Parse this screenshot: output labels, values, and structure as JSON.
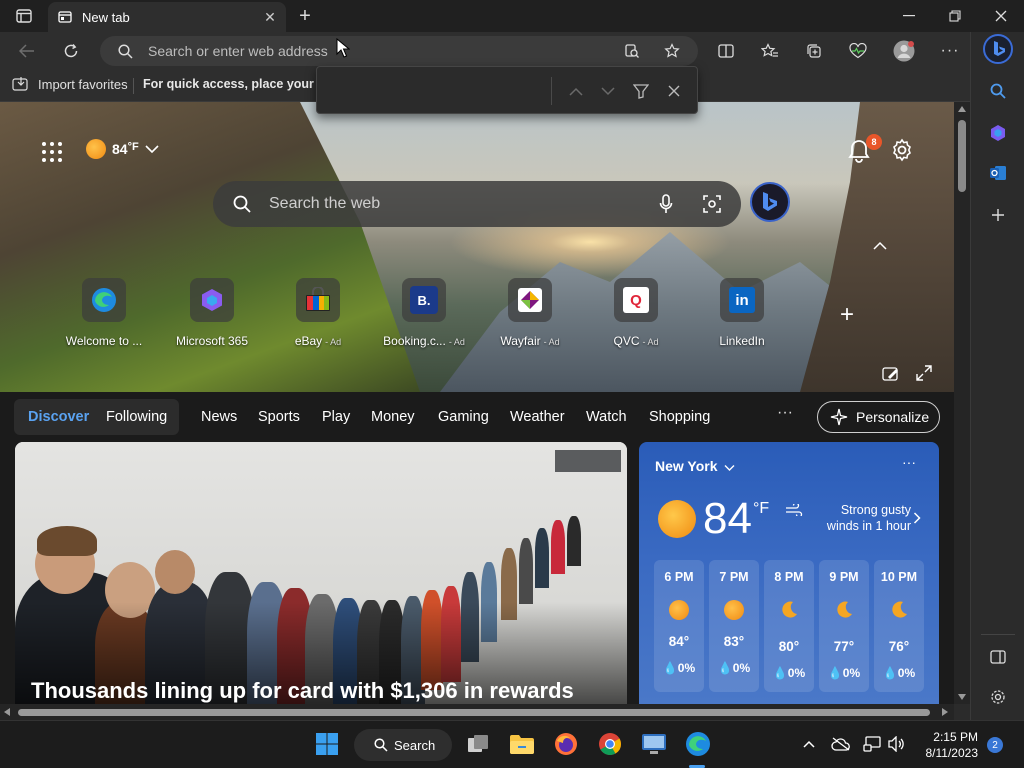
{
  "browser": {
    "tab_title": "New tab",
    "address_placeholder": "Search or enter web address"
  },
  "favorites": {
    "import_label": "Import favorites",
    "hint": "For quick access, place your fav"
  },
  "newtab": {
    "weather_temp": "84",
    "weather_unit": "°F",
    "notifications_count": "8",
    "search_placeholder": "Search the web",
    "quick_links": [
      {
        "label": "Welcome to ...",
        "ad": "",
        "icon": "edge-icon"
      },
      {
        "label": "Microsoft 365",
        "ad": "",
        "icon": "microsoft-365-icon"
      },
      {
        "label": "eBay",
        "ad": "- Ad",
        "icon": "ebay-icon"
      },
      {
        "label": "Booking.c...",
        "ad": "- Ad",
        "icon": "booking-icon"
      },
      {
        "label": "Wayfair",
        "ad": "- Ad",
        "icon": "wayfair-icon"
      },
      {
        "label": "QVC",
        "ad": "- Ad",
        "icon": "qvc-icon"
      },
      {
        "label": "LinkedIn",
        "ad": "",
        "icon": "linkedin-icon"
      }
    ],
    "booking_letter": "B.",
    "linkedin_letters": "in",
    "qvc_letter": "Q"
  },
  "feed_nav": {
    "items": [
      "Discover",
      "Following",
      "News",
      "Sports",
      "Play",
      "Money",
      "Gaming",
      "Weather",
      "Watch",
      "Shopping"
    ],
    "more": "···",
    "personalize": "Personalize"
  },
  "news": {
    "headline": "Thousands lining up for card with $1,306 in rewards"
  },
  "weather": {
    "city": "New York",
    "temp": "84",
    "unit": "°F",
    "wind": "Strong gusty winds in 1 hour",
    "more": "···",
    "hourly": [
      {
        "time": "6 PM",
        "temp": "84°",
        "precip": "0%",
        "icon": "sun-icon"
      },
      {
        "time": "7 PM",
        "temp": "83°",
        "precip": "0%",
        "icon": "sun-icon"
      },
      {
        "time": "8 PM",
        "temp": "80°",
        "precip": "0%",
        "icon": "moon-icon"
      },
      {
        "time": "9 PM",
        "temp": "77°",
        "precip": "0%",
        "icon": "moon-icon"
      },
      {
        "time": "10 PM",
        "temp": "76°",
        "precip": "0%",
        "icon": "moon-icon"
      }
    ]
  },
  "taskbar": {
    "search_label": "Search",
    "time": "2:15 PM",
    "date": "8/11/2023",
    "notifications": "2"
  },
  "colors": {
    "accent": "#5aa2f0",
    "weather_card": "#2a5cb8",
    "sun": "#f5a623"
  }
}
